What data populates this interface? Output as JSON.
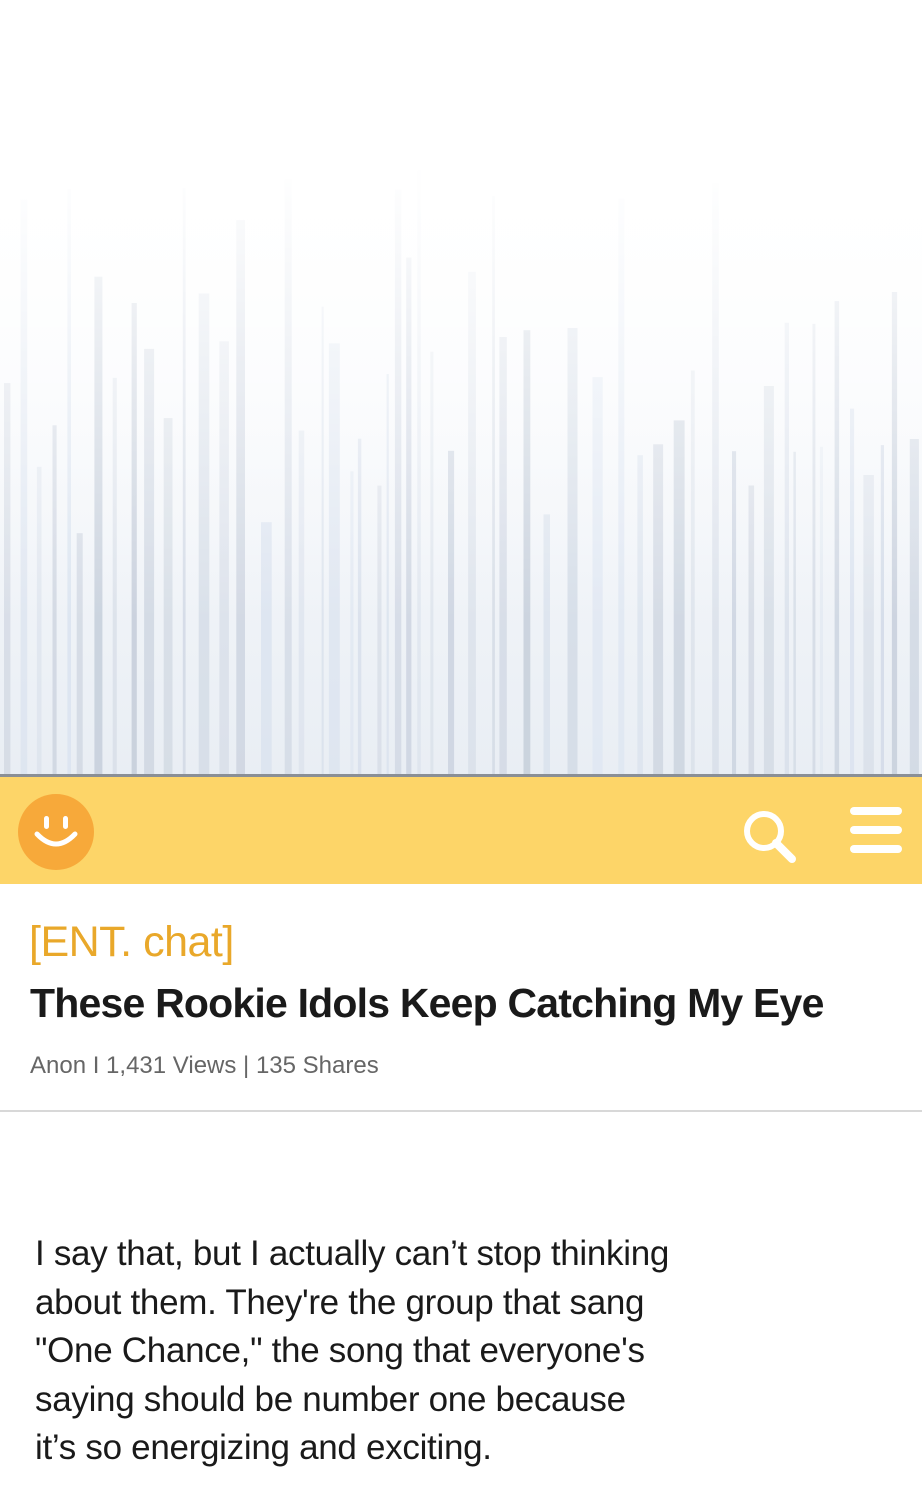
{
  "colors": {
    "app_bar": "#fdd568",
    "logo": "#f7a93a",
    "category": "#e9a82a",
    "headline": "#1a1a1a",
    "meta": "#666666"
  },
  "header": {
    "logo_icon": "smiley-icon",
    "search_icon": "search-icon",
    "menu_icon": "hamburger-menu-icon"
  },
  "article": {
    "category": "[ENT. chat]",
    "title": "These Rookie Idols Keep Catching My Eye",
    "meta": "Anon I 1,431 Views | 135 Shares",
    "body_lines": [
      "I say that, but I actually can’t stop thinking",
      "about them. They're the group that sang",
      "\"One Chance,\" the song that everyone's",
      "saying should be number one because",
      "it’s so energizing and exciting."
    ]
  }
}
